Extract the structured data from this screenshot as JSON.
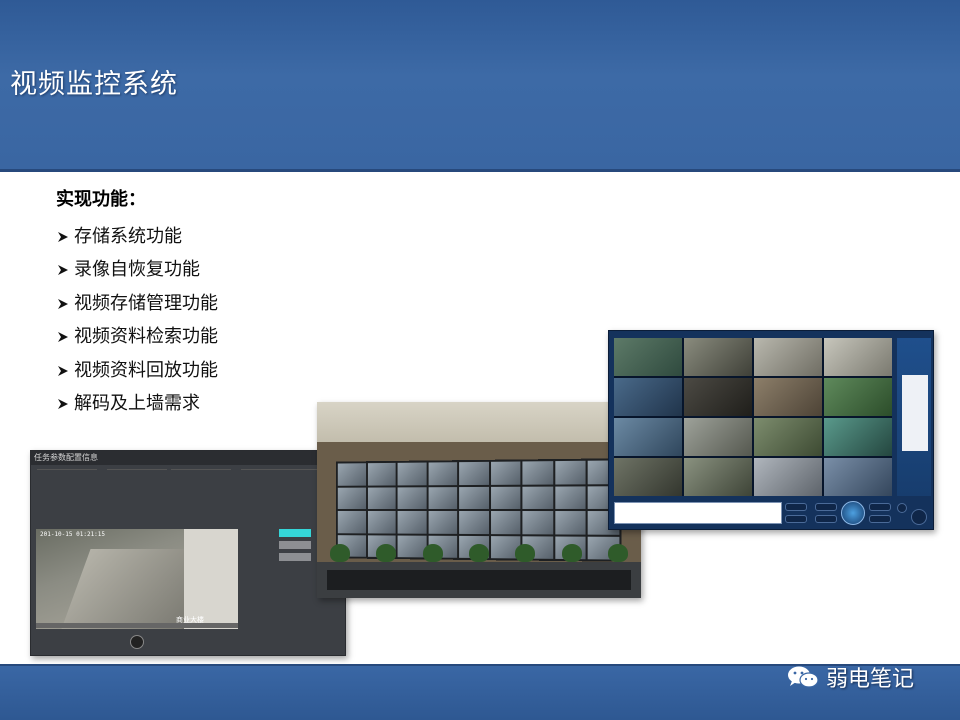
{
  "slide": {
    "title": "视频监控系统",
    "section_heading": "实现功能：",
    "features": [
      "存储系统功能",
      "录像自恢复功能",
      "视频存储管理功能",
      "视频资料检索功能",
      "视频资料回放功能",
      "解码及上墙需求"
    ],
    "brand": "弱电笔记"
  },
  "task_window": {
    "title": "任务参数配置信息",
    "timestamp": "201-10-15 01:21:15",
    "watermark": "商业大楼"
  },
  "colors": {
    "header_blue": "#3d6aa6",
    "footer_blue": "#2e5892",
    "client_bg": "#14325c",
    "highlight_cyan": "#35d6d8"
  }
}
